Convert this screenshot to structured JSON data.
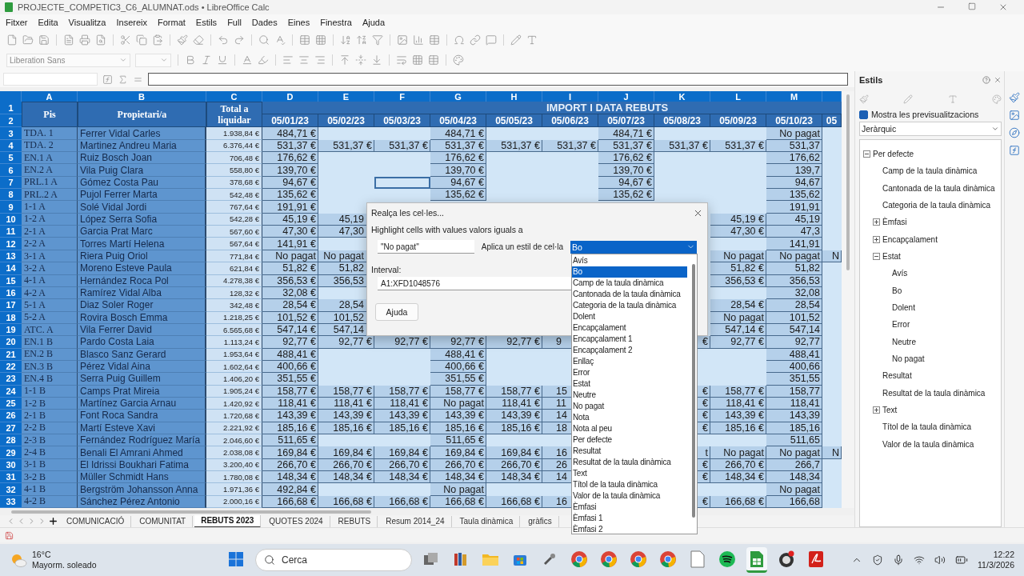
{
  "window": {
    "title": "PROJECTE_COMPETIC3_C6_ALUMNAT.ods • LibreOffice Calc"
  },
  "menu": [
    "Fitxer",
    "Edita",
    "Visualitza",
    "Insereix",
    "Format",
    "Estils",
    "Full",
    "Dades",
    "Eines",
    "Finestra",
    "Ajuda"
  ],
  "font_name": "Liberation Sans",
  "sheet": {
    "columns": [
      "A",
      "B",
      "C",
      "D",
      "E",
      "F",
      "G",
      "H",
      "I",
      "J",
      "K",
      "L",
      "M"
    ],
    "header": {
      "row_numbers": [
        "1",
        "2"
      ],
      "pis": "Pis",
      "owner": "Propietari/a",
      "total": "Total a liquidar",
      "group": "IMPORT I DATA REBUTS",
      "dates": [
        "05/01/23",
        "05/02/23",
        "05/03/23",
        "05/04/23",
        "05/05/23",
        "05/06/23",
        "05/07/23",
        "05/08/23",
        "05/09/23",
        "05/10/23",
        "05"
      ]
    },
    "rows": [
      {
        "number": "3",
        "pis": "TDA. 1",
        "owner": "Ferrer Vidal Carles",
        "total": "1.938,84 €",
        "cells": {
          "D": "484,71 €",
          "G": "484,71 €",
          "J": "484,71 €",
          "M": "No pagat"
        }
      },
      {
        "number": "4",
        "pis": "TDA. 2",
        "owner": "Martinez Andreu Maria",
        "total": "6.376,44 €",
        "cells": {
          "D": "531,37 €",
          "E": "531,37 €",
          "F": "531,37 €",
          "G": "531,37 €",
          "H": "531,37 €",
          "I": "531,37 €",
          "J": "531,37 €",
          "K": "531,37 €",
          "L": "531,37 €",
          "M": "531,37"
        }
      },
      {
        "number": "5",
        "pis": "EN.1 A",
        "owner": "Ruiz Bosch Joan",
        "total": "706,48 €",
        "cells": {
          "D": "176,62 €",
          "G": "176,62 €",
          "J": "176,62 €",
          "M": "176,62"
        }
      },
      {
        "number": "6",
        "pis": "EN.2 A",
        "owner": "Vila Puig Clara",
        "total": "558,80 €",
        "cells": {
          "D": "139,70 €",
          "G": "139,70 €",
          "J": "139,70 €",
          "M": "139,7"
        }
      },
      {
        "number": "7",
        "pis": "PRL.1 A",
        "owner": "Gómez Costa Pau",
        "total": "378,68 €",
        "cells": {
          "D": "94,67 €",
          "F": {
            "selected": true
          },
          "G": "94,67 €",
          "J": "94,67 €",
          "M": "94,67"
        }
      },
      {
        "number": "8",
        "pis": "PRL.2 A",
        "owner": "Pujol Ferrer Marta",
        "total": "542,48 €",
        "cells": {
          "D": "135,62 €",
          "G": "135,62 €",
          "J": "135,62 €",
          "M": "135,62"
        }
      },
      {
        "number": "9",
        "pis": "1-1 A",
        "owner": "Solé Vidal Jordi",
        "total": "767,64 €",
        "cells": {
          "D": "191,91 €",
          "M": "191,91"
        }
      },
      {
        "number": "10",
        "pis": "1-2 A",
        "owner": "López Serra Sofia",
        "total": "542,28 €",
        "cells": {
          "D": "45,19 €",
          "E": "45,19",
          "L": "45,19 €",
          "M": "45,19"
        }
      },
      {
        "number": "11",
        "pis": "2-1 A",
        "owner": "Garcia Prat Marc",
        "total": "567,60 €",
        "cells": {
          "D": "47,30 €",
          "E": "47,30",
          "L": "47,30 €",
          "M": "47,3"
        }
      },
      {
        "number": "12",
        "pis": "2-2 A",
        "owner": "Torres Martí Helena",
        "total": "567,64 €",
        "cells": {
          "D": "141,91 €",
          "M": "141,91"
        }
      },
      {
        "number": "13",
        "pis": "3-1 A",
        "owner": "Riera Puig Oriol",
        "total": "771,84 €",
        "cells": {
          "D": "No pagat",
          "E": "No pagat",
          "L": "No pagat",
          "M": "No pagat",
          "N": "N"
        }
      },
      {
        "number": "14",
        "pis": "3-2 A",
        "owner": "Moreno Esteve Paula",
        "total": "621,84 €",
        "cells": {
          "D": "51,82 €",
          "E": "51,82",
          "L": "51,82 €",
          "M": "51,82"
        }
      },
      {
        "number": "15",
        "pis": "4-1 A",
        "owner": "Hernández Roca Pol",
        "total": "4.278,38 €",
        "cells": {
          "D": "356,53 €",
          "E": "356,53",
          "L": "356,53 €",
          "M": "356,53"
        }
      },
      {
        "number": "16",
        "pis": "4-2 A",
        "owner": "Ramírez Vidal Alba",
        "total": "128,32 €",
        "cells": {
          "D": "32,08 €",
          "M": "32,08"
        }
      },
      {
        "number": "17",
        "pis": "5-1 A",
        "owner": "Diaz Soler Roger",
        "total": "342,48 €",
        "cells": {
          "D": "28,54 €",
          "E": "28,54",
          "L": "28,54 €",
          "M": "28,54"
        }
      },
      {
        "number": "18",
        "pis": "5-2 A",
        "owner": "Rovira Bosch Emma",
        "total": "1.218,25 €",
        "cells": {
          "D": "101,52 €",
          "E": "101,52",
          "L": "No pagat",
          "M": "101,52"
        }
      },
      {
        "number": "19",
        "pis": "ATC. A",
        "owner": "Vila Ferrer David",
        "total": "6.565,68 €",
        "cells": {
          "D": "547,14 €",
          "E": "547,14",
          "L": "547,14 €",
          "M": "547,14"
        }
      },
      {
        "number": "20",
        "pis": "EN.1 B",
        "owner": "Pardo Costa Laia",
        "total": "1.113,24 €",
        "cells": {
          "D": "92,77 €",
          "E": "92,77 €",
          "F": "92,77 €",
          "G": "92,77 €",
          "H": "92,77 €",
          "I": "9",
          "K": "€",
          "L": "92,77 €",
          "M": "92,77"
        }
      },
      {
        "number": "21",
        "pis": "EN.2 B",
        "owner": "Blasco Sanz Gerard",
        "total": "1.953,64 €",
        "cells": {
          "D": "488,41 €",
          "G": "488,41 €",
          "M": "488,41"
        }
      },
      {
        "number": "22",
        "pis": "EN.3 B",
        "owner": "Pérez Vidal Aina",
        "total": "1.602,64 €",
        "cells": {
          "D": "400,66 €",
          "G": "400,66 €",
          "M": "400,66"
        }
      },
      {
        "number": "23",
        "pis": "EN.4 B",
        "owner": "Serra Puig Guillem",
        "total": "1.406,20 €",
        "cells": {
          "D": "351,55 €",
          "G": "351,55 €",
          "M": "351,55"
        }
      },
      {
        "number": "24",
        "pis": "1-1 B",
        "owner": "Camps Prat Mireia",
        "total": "1.905,24 €",
        "cells": {
          "D": "158,77 €",
          "E": "158,77 €",
          "F": "158,77 €",
          "G": "158,77 €",
          "H": "158,77 €",
          "I": "15",
          "K": "€",
          "L": "158,77 €",
          "M": "158,77"
        }
      },
      {
        "number": "25",
        "pis": "1-2 B",
        "owner": "Martínez Garcia Arnau",
        "total": "1.420,92 €",
        "cells": {
          "D": "118,41 €",
          "E": "118,41 €",
          "F": "118,41 €",
          "G": "No pagat",
          "H": "118,41 €",
          "I": "11",
          "K": "€",
          "L": "118,41 €",
          "M": "118,41"
        }
      },
      {
        "number": "26",
        "pis": "2-1 B",
        "owner": "Font Roca Sandra",
        "total": "1.720,68 €",
        "cells": {
          "D": "143,39 €",
          "E": "143,39 €",
          "F": "143,39 €",
          "G": "143,39 €",
          "H": "143,39 €",
          "I": "14",
          "K": "€",
          "L": "143,39 €",
          "M": "143,39"
        }
      },
      {
        "number": "27",
        "pis": "2-2 B",
        "owner": "Martí Esteve Xavi",
        "total": "2.221,92 €",
        "cells": {
          "D": "185,16 €",
          "E": "185,16 €",
          "F": "185,16 €",
          "G": "185,16 €",
          "H": "185,16 €",
          "I": "18",
          "K": "€",
          "L": "185,16 €",
          "M": "185,16"
        }
      },
      {
        "number": "28",
        "pis": "2-3 B",
        "owner": "Fernández Rodríguez María",
        "total": "2.046,60 €",
        "cells": {
          "D": "511,65 €",
          "G": "511,65 €",
          "M": "511,65"
        }
      },
      {
        "number": "29",
        "pis": "2-4 B",
        "owner": "Benali El Amrani Ahmed",
        "total": "2.038,08 €",
        "cells": {
          "D": "169,84 €",
          "E": "169,84 €",
          "F": "169,84 €",
          "G": "169,84 €",
          "H": "169,84 €",
          "I": "16",
          "K": "t",
          "L": "No pagat",
          "M": "No pagat",
          "N": "N"
        }
      },
      {
        "number": "30",
        "pis": "3-1 B",
        "owner": "El Idrissi Boukhari Fatima",
        "total": "3.200,40 €",
        "cells": {
          "D": "266,70 €",
          "E": "266,70 €",
          "F": "266,70 €",
          "G": "266,70 €",
          "H": "266,70 €",
          "I": "26",
          "K": "€",
          "L": "266,70 €",
          "M": "266,7"
        }
      },
      {
        "number": "31",
        "pis": "3-2 B",
        "owner": "Müller Schmidt Hans",
        "total": "1.780,08 €",
        "cells": {
          "D": "148,34 €",
          "E": "148,34 €",
          "F": "148,34 €",
          "G": "148,34 €",
          "H": "148,34 €",
          "I": "14",
          "K": "€",
          "L": "148,34 €",
          "M": "148,34"
        }
      },
      {
        "number": "32",
        "pis": "4-1 B",
        "owner": "Bergström Johansson Anna",
        "total": "1.971,36 €",
        "cells": {
          "D": "492,84 €",
          "G": "No pagat",
          "M": "No pagat"
        }
      },
      {
        "number": "33",
        "pis": "4-2 B",
        "owner": "Sánchez Pérez Antonio",
        "total": "2.000,16 €",
        "cells": {
          "D": "166,68 €",
          "E": "166,68 €",
          "F": "166,68 €",
          "G": "166,68 €",
          "H": "166,68 €",
          "I": "16",
          "K": "€",
          "L": "166,68 €",
          "M": "166,68"
        }
      }
    ]
  },
  "sheet_tabs": [
    {
      "label": "COMUNICACIÓ",
      "selected": false
    },
    {
      "label": "COMUNITAT",
      "selected": false
    },
    {
      "label": "REBUTS 2023",
      "selected": true
    },
    {
      "label": "QUOTES 2024",
      "selected": false
    },
    {
      "label": "REBUTS",
      "selected": false
    },
    {
      "label": "Resum 2014_24",
      "selected": false
    },
    {
      "label": "Taula dinàmica",
      "selected": false
    },
    {
      "label": "gràfics",
      "selected": false
    }
  ],
  "sidebar": {
    "title": "Estils",
    "preview": {
      "label": "Mostra les previsualitzacions",
      "checked": true
    },
    "filter": "Jeràrquic",
    "tree": [
      {
        "label": "Per defecte",
        "expanded": true,
        "children": [
          {
            "label": "Camp de la taula dinàmica"
          },
          {
            "label": "Cantonada de la taula dinàmica"
          },
          {
            "label": "Categoria de la taula dinàmica"
          },
          {
            "label": "Èmfasi",
            "expanded": false
          },
          {
            "label": "Encapçalament",
            "expanded": false
          },
          {
            "label": "Estat",
            "expanded": true,
            "children": [
              {
                "label": "Avís"
              },
              {
                "label": "Bo"
              },
              {
                "label": "Dolent"
              },
              {
                "label": "Error"
              },
              {
                "label": "Neutre"
              },
              {
                "label": "No pagat"
              }
            ]
          },
          {
            "label": "Resultat"
          },
          {
            "label": "Resultat de la taula dinàmica"
          },
          {
            "label": "Text",
            "expanded": false
          },
          {
            "label": "Títol de la taula dinàmica"
          },
          {
            "label": "Valor de la taula dinàmica"
          }
        ]
      }
    ]
  },
  "dialog": {
    "title": "Realça les cel·les...",
    "prompt": "Highlight cells with values valors iguals a",
    "value": "\"No pagat\"",
    "style_label": "Aplica un estil de cel·la",
    "style_value": "Bo",
    "range_label": "Interval:",
    "range": "A1:XFD1048576",
    "help": "Ajuda",
    "style_options": [
      {
        "label": "Avís",
        "selected": false
      },
      {
        "label": "Bo",
        "selected": true
      },
      {
        "label": "Camp de la taula dinàmica",
        "selected": false
      },
      {
        "label": "Cantonada de la taula dinàmica",
        "selected": false
      },
      {
        "label": "Categoria de la taula dinàmica",
        "selected": false
      },
      {
        "label": "Dolent",
        "selected": false
      },
      {
        "label": "Encapçalament",
        "selected": false
      },
      {
        "label": "Encapçalament 1",
        "selected": false
      },
      {
        "label": "Encapçalament 2",
        "selected": false
      },
      {
        "label": "Enllaç",
        "selected": false
      },
      {
        "label": "Error",
        "selected": false
      },
      {
        "label": "Estat",
        "selected": false
      },
      {
        "label": "Neutre",
        "selected": false
      },
      {
        "label": "No pagat",
        "selected": false
      },
      {
        "label": "Nota",
        "selected": false
      },
      {
        "label": "Nota al peu",
        "selected": false
      },
      {
        "label": "Per defecte",
        "selected": false
      },
      {
        "label": "Resultat",
        "selected": false
      },
      {
        "label": "Resultat de la taula dinàmica",
        "selected": false
      },
      {
        "label": "Text",
        "selected": false
      },
      {
        "label": "Títol de la taula dinàmica",
        "selected": false
      },
      {
        "label": "Valor de la taula dinàmica",
        "selected": false
      },
      {
        "label": "Èmfasi",
        "selected": false
      },
      {
        "label": "Èmfasi 1",
        "selected": false
      },
      {
        "label": "Èmfasi 2",
        "selected": false
      }
    ]
  },
  "taskbar": {
    "weather": {
      "temp": "16°C",
      "desc": "Mayorm. soleado"
    },
    "search": "Cerca",
    "apps": [
      {
        "kind": "windows",
        "active": false
      },
      {
        "kind": "taskview",
        "active": false
      },
      {
        "kind": "books",
        "active": false
      },
      {
        "kind": "folder",
        "active": false
      },
      {
        "kind": "store",
        "active": false
      },
      {
        "kind": "tool",
        "active": false
      },
      {
        "kind": "browser",
        "active": false
      },
      {
        "kind": "browser",
        "active": false
      },
      {
        "kind": "browser",
        "active": false
      },
      {
        "kind": "browser",
        "active": false
      },
      {
        "kind": "document",
        "active": false
      },
      {
        "kind": "music",
        "active": false
      },
      {
        "kind": "spreadsheet",
        "active": true
      },
      {
        "kind": "record",
        "active": false
      },
      {
        "kind": "pdf",
        "active": false
      }
    ],
    "clock": {
      "time": "12:22",
      "date": "11/3/2026"
    }
  }
}
